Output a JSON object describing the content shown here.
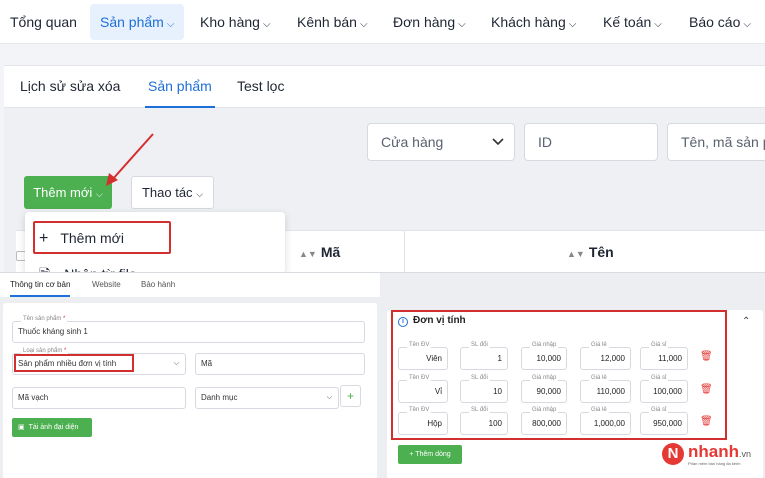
{
  "nav": {
    "items": [
      {
        "label": "Tổng quan",
        "dropdown": false
      },
      {
        "label": "Sản phẩm",
        "dropdown": true,
        "active": true
      },
      {
        "label": "Kho hàng",
        "dropdown": true
      },
      {
        "label": "Kênh bán",
        "dropdown": true
      },
      {
        "label": "Đơn hàng",
        "dropdown": true
      },
      {
        "label": "Khách hàng",
        "dropdown": true
      },
      {
        "label": "Kế toán",
        "dropdown": true
      },
      {
        "label": "Báo cáo",
        "dropdown": true
      }
    ]
  },
  "tabs": [
    {
      "label": "Lịch sử sửa xóa"
    },
    {
      "label": "Sản phẩm",
      "active": true
    },
    {
      "label": "Test lọc"
    }
  ],
  "filters": {
    "store": "Cửa hàng",
    "id": "ID",
    "name": "Tên, mã sản p"
  },
  "actions": {
    "add": "Thêm mới",
    "ops": "Thao tác"
  },
  "dropdown": {
    "items": [
      "Thêm mới",
      "Nhập từ file"
    ]
  },
  "table": {
    "col_code": "Mã",
    "col_name": "Tên"
  },
  "inset": {
    "tabs": [
      "Thông tin cơ bản",
      "Website",
      "Bảo hành"
    ],
    "product_name_label": "Tên sản phẩm",
    "product_name_value": "Thuốc kháng sinh 1",
    "product_type_label": "Loại sản phẩm",
    "product_type_value": "Sản phẩm nhiều đơn vị tính",
    "code_placeholder": "Mã",
    "barcode_placeholder": "Mã vạch",
    "category_placeholder": "Danh mục",
    "upload_label": "Tải ảnh đại diện",
    "units": {
      "title": "Đơn vị tính",
      "field_labels": [
        "Tên ĐV",
        "SL đổi",
        "Giá nhập",
        "Giá lẻ",
        "Giá sỉ"
      ],
      "rows": [
        {
          "name": "Viên",
          "qty": "1",
          "cost": "10,000",
          "retail": "12,000",
          "wholesale": "11,000"
        },
        {
          "name": "Vỉ",
          "qty": "10",
          "cost": "90,000",
          "retail": "110,000",
          "wholesale": "100,000"
        },
        {
          "name": "Hộp",
          "qty": "100",
          "cost": "800,000",
          "retail": "1,000,00",
          "wholesale": "950,000"
        }
      ],
      "add_row_label": "Thêm dòng"
    },
    "logo": {
      "word": "nhanh",
      "suffix": ".vn",
      "tagline": "Phần mềm bán hàng đa kênh"
    }
  },
  "colors": {
    "accent": "#1e6fd9",
    "green": "#4caf50",
    "red": "#d32f2f"
  }
}
